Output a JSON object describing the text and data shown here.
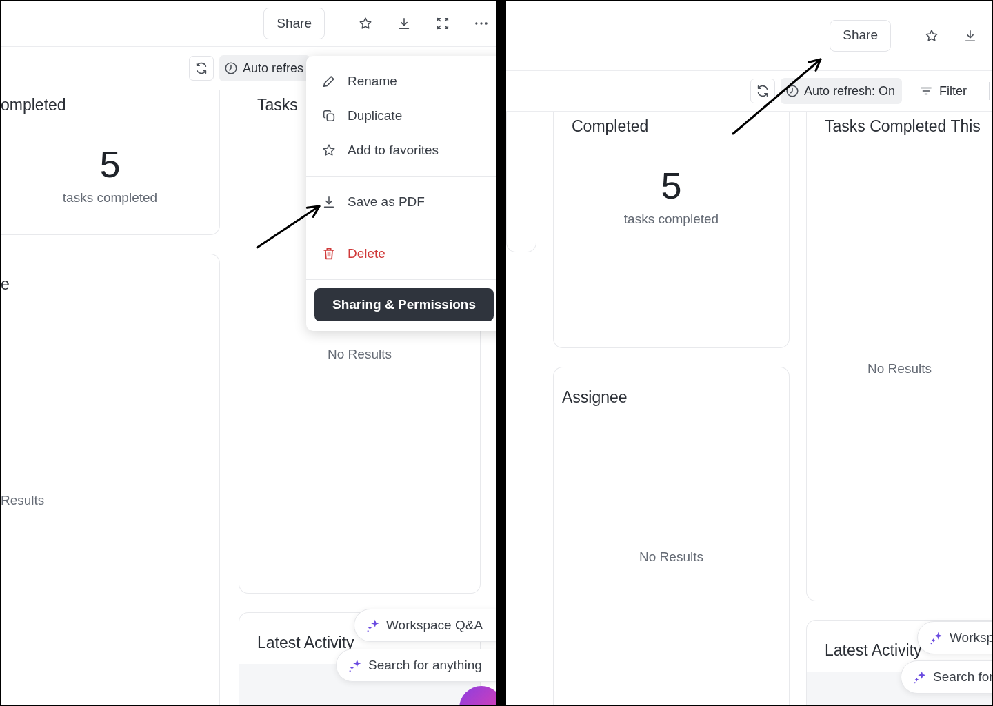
{
  "panels": [
    {
      "topbar": {
        "share_button": "Share",
        "actions": [
          {
            "kind": "star"
          },
          {
            "kind": "download"
          },
          {
            "kind": "expand"
          },
          {
            "kind": "more"
          }
        ]
      },
      "toolbar": {
        "auto_refresh": "Auto refres"
      },
      "columns": [
        {
          "cards": [
            {
              "kind": "metric",
              "title": "ompleted",
              "value": "5",
              "caption": "tasks completed"
            },
            {
              "kind": "empty",
              "title": "e",
              "message": "Results"
            }
          ]
        },
        {
          "cards": [
            {
              "kind": "empty",
              "title": "Tasks",
              "message": "No Results"
            },
            {
              "kind": "activity",
              "title": "Latest Activity"
            }
          ]
        }
      ],
      "menu": {
        "groups": [
          [
            {
              "kind": "pencil",
              "label": "Rename",
              "danger": false
            },
            {
              "kind": "copy",
              "label": "Duplicate",
              "danger": false
            },
            {
              "kind": "star",
              "label": "Add to favorites",
              "danger": false
            }
          ],
          [
            {
              "kind": "download",
              "label": "Save as PDF",
              "danger": false
            }
          ],
          [
            {
              "kind": "trash",
              "label": "Delete",
              "danger": true
            }
          ]
        ],
        "button": "Sharing & Permissions"
      },
      "pills": [
        {
          "label": "Workspace Q&A"
        },
        {
          "label": "Search for anything"
        }
      ],
      "fab": true,
      "annotations": [
        {
          "kind": "arrow"
        }
      ]
    },
    {
      "topbar": {
        "share_button": "Share",
        "actions": [
          {
            "kind": "star"
          },
          {
            "kind": "download"
          }
        ]
      },
      "toolbar": {
        "auto_refresh": "Auto refresh: On",
        "filter": "Filter"
      },
      "columns": [
        {
          "cards": [
            {
              "kind": "blank"
            }
          ]
        },
        {
          "cards": [
            {
              "kind": "metric",
              "title": "Completed",
              "value": "5",
              "caption": "tasks completed"
            },
            {
              "kind": "empty",
              "title": "Assignee",
              "message": "No Results"
            }
          ]
        },
        {
          "cards": [
            {
              "kind": "empty",
              "title": "Tasks Completed This",
              "message": "No Results"
            },
            {
              "kind": "activity",
              "title": "Latest Activity"
            }
          ]
        }
      ],
      "pills": [
        {
          "label": "Worksp"
        },
        {
          "label": "Search for"
        }
      ],
      "annotations": [
        {
          "kind": "arrow"
        }
      ]
    }
  ]
}
